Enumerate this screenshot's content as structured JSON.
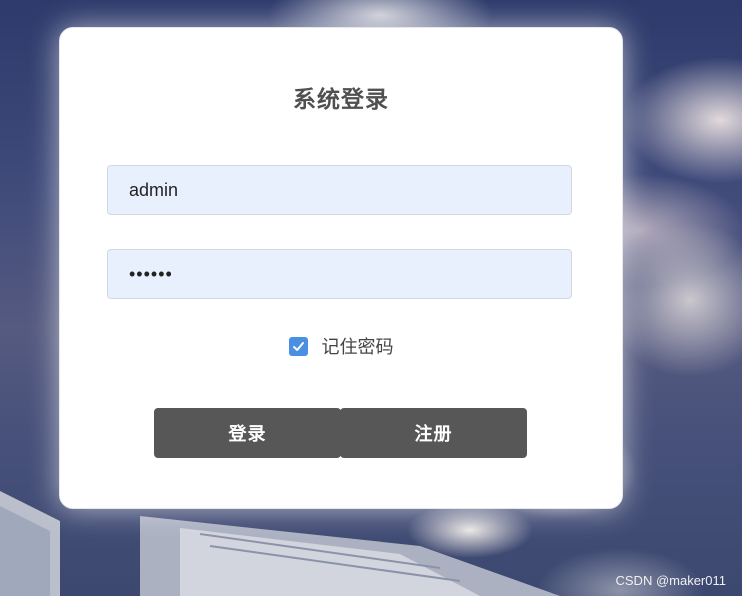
{
  "login_form": {
    "title": "系统登录",
    "username_value": "admin",
    "password_value": "••••••",
    "remember_label": "记住密码",
    "remember_checked": true,
    "login_button": "登录",
    "register_button": "注册"
  },
  "watermark": "CSDN @maker011",
  "colors": {
    "button_bg": "#575757",
    "input_bg": "#e8f0fe",
    "checkbox_accent": "#4a90e2"
  }
}
